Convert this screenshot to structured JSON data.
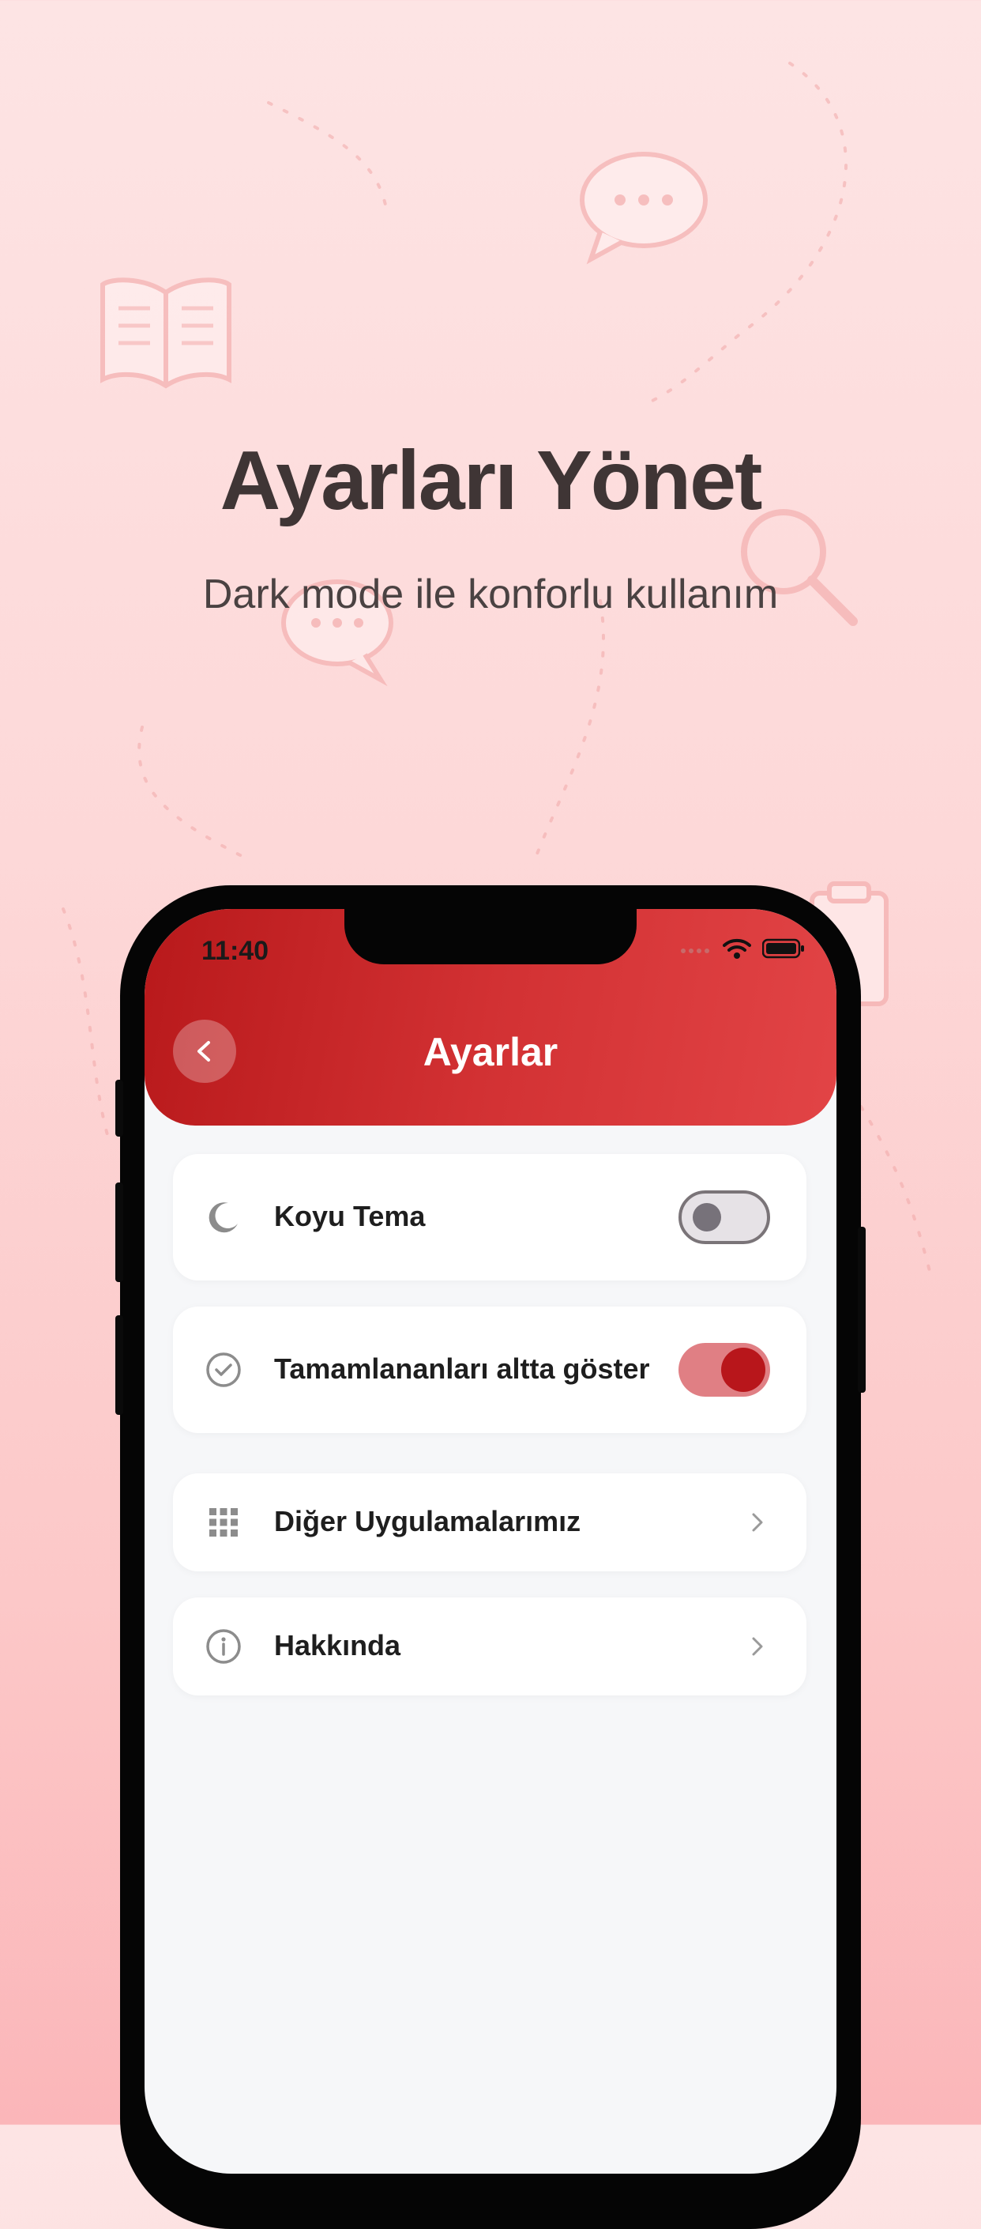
{
  "hero": {
    "title": "Ayarları Yönet",
    "subtitle": "Dark mode ile konforlu kullanım"
  },
  "status_bar": {
    "time": "11:40"
  },
  "header": {
    "title": "Ayarlar",
    "back_icon": "chevron-left-icon"
  },
  "settings": {
    "dark_theme": {
      "label": "Koyu Tema",
      "icon": "moon-icon",
      "enabled": false
    },
    "completed_bottom": {
      "label": "Tamamlananları altta göster",
      "icon": "check-circle-icon",
      "enabled": true
    },
    "other_apps": {
      "label": "Diğer Uygulamalarımız",
      "icon": "grid-icon"
    },
    "about": {
      "label": "Hakkında",
      "icon": "info-icon"
    }
  },
  "colors": {
    "accent": "#c52326",
    "toggle_on_track": "#e07f84",
    "toggle_on_knob": "#b8161b",
    "toggle_off_track": "#e6e2e6",
    "screen_bg": "#f6f7f9"
  }
}
